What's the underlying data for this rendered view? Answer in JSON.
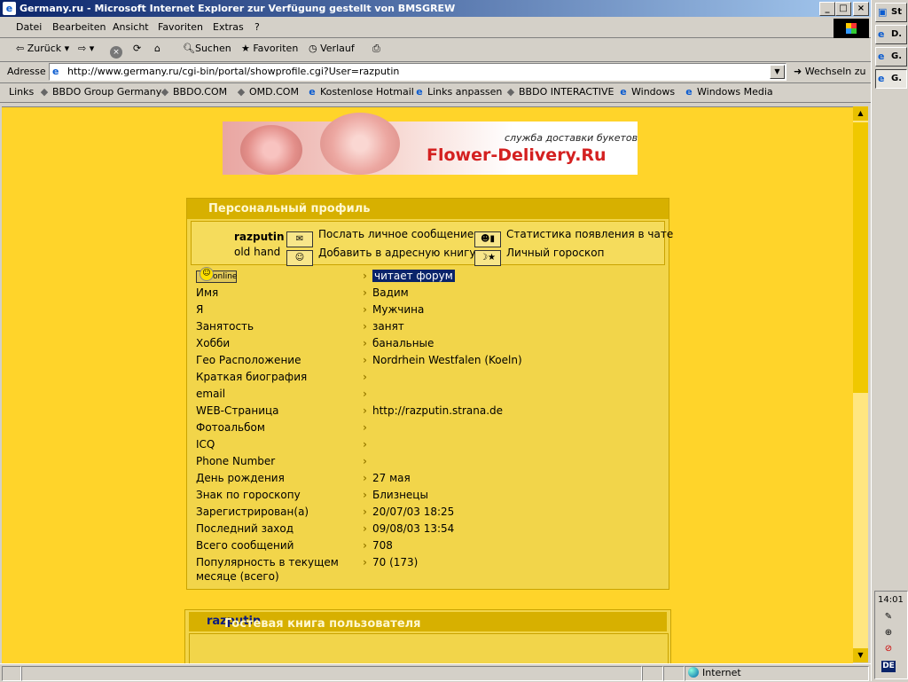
{
  "window": {
    "title": "Germany.ru - Microsoft Internet Explorer  zur Verfügung gestellt von BMSGREW"
  },
  "menu": [
    "Datei",
    "Bearbeiten",
    "Ansicht",
    "Favoriten",
    "Extras",
    "?"
  ],
  "toolbar": {
    "back": "Zurück",
    "search": "Suchen",
    "favorites": "Favoriten",
    "history": "Verlauf"
  },
  "address": {
    "label": "Adresse",
    "url": "http://www.germany.ru/cgi-bin/portal/showprofile.cgi?User=razputin",
    "go": "Wechseln zu"
  },
  "links": {
    "label": "Links",
    "items": [
      "BBDO Group Germany",
      "BBDO.COM",
      "OMD.COM",
      "Kostenlose Hotmail",
      "Links anpassen",
      "BBDO INTERACTIVE",
      "Windows",
      "Windows Media"
    ]
  },
  "banner": {
    "slogan": "служба доставки букетов",
    "brand": "Flower-Delivery.Ru"
  },
  "profile": {
    "title": "Персональный профиль",
    "username": "razputin",
    "rank": "old hand",
    "actions": [
      "Послать личное сообщение",
      "Добавить в адресную книгу",
      "Статистика появления в чате",
      "Личный гороскоп"
    ],
    "online_label": "online",
    "status": "читает форум",
    "rows": [
      {
        "label": "Имя",
        "value": "Вадим"
      },
      {
        "label": "Я",
        "value": "Мужчина"
      },
      {
        "label": "Занятость",
        "value": "занят"
      },
      {
        "label": "Хобби",
        "value": "банальные"
      },
      {
        "label": "Гео Расположение",
        "value": "Nordrhein Westfalen (Koeln)"
      },
      {
        "label": "Краткая биография",
        "value": ""
      },
      {
        "label": "email",
        "value": ""
      },
      {
        "label": "WEB-Страница",
        "value": "http://razputin.strana.de"
      },
      {
        "label": "Фотоальбом",
        "value": ""
      },
      {
        "label": "ICQ",
        "value": ""
      },
      {
        "label": "Phone Number",
        "value": ""
      },
      {
        "label": "День рождения",
        "value": "27 мая"
      },
      {
        "label": "Знак по гороскопу",
        "value": "Близнецы"
      },
      {
        "label": "Зарегистрирован(а)",
        "value": "20/07/03 18:25"
      },
      {
        "label": "Последний заход",
        "value": "09/08/03 13:54"
      },
      {
        "label": "Всего сообщений",
        "value": "708"
      }
    ],
    "popularity_label_1": "Популярность в текущем",
    "popularity_label_2": "месяце (всего)",
    "popularity_value": "70 (173)"
  },
  "guestbook": {
    "title": "Гостевая книга пользователя",
    "user": "razputin"
  },
  "statusbar": {
    "zone": "Internet"
  },
  "taskbar": {
    "tasks": [
      "St",
      "D.",
      "G.",
      "G."
    ],
    "clock": "14:01",
    "lang": "DE"
  }
}
